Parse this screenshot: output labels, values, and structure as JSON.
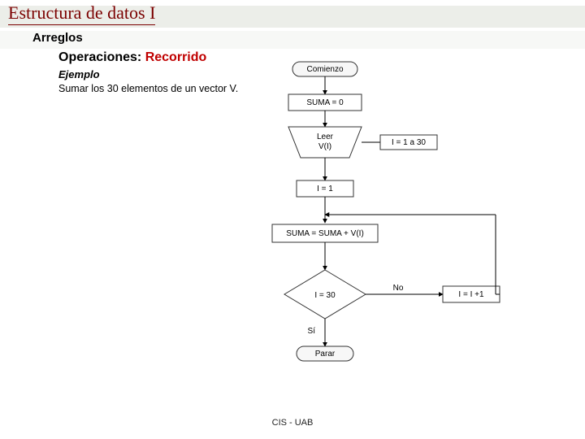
{
  "header": {
    "title": "Estructura de datos I",
    "subtitle": "Arreglos",
    "ops_prefix": "Operaciones: ",
    "ops_highlight": "Recorrido",
    "example_label": "Ejemplo",
    "example_text": "Sumar los 30 elementos de un vector V."
  },
  "flowchart": {
    "start": "Comienzo",
    "init_sum": "SUMA = 0",
    "read": "Leer V(I)",
    "loop_range": "I = 1 a 30",
    "set_i": "I = 1",
    "accumulate": "SUMA = SUMA + V(I)",
    "cond": "I = 30",
    "cond_no": "No",
    "cond_yes": "Sí",
    "increment": "I = I +1",
    "stop": "Parar"
  },
  "footer": {
    "text": "CIS - UAB"
  }
}
